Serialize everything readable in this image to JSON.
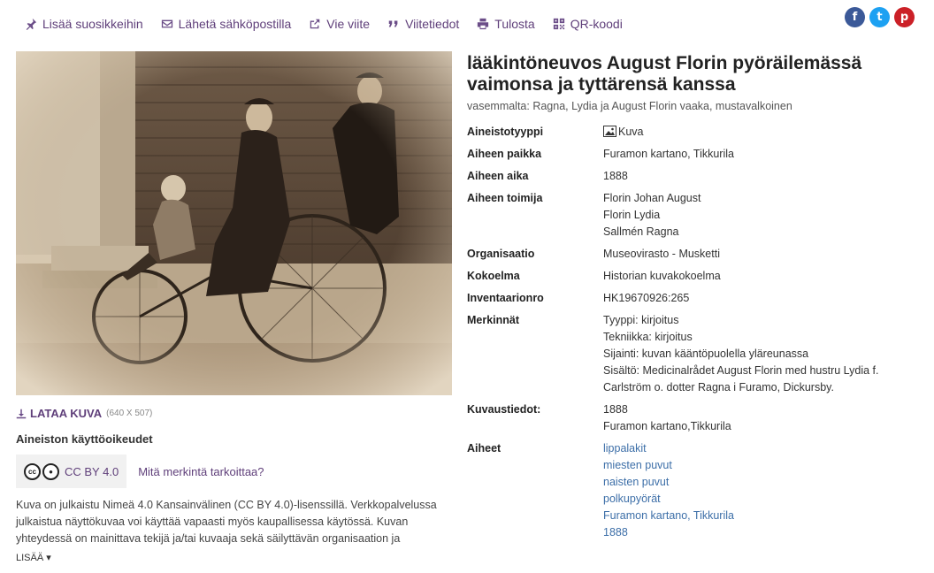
{
  "toolbar": {
    "favorite": "Lisää suosikkeihin",
    "email": "Lähetä sähköpostilla",
    "export": "Vie viite",
    "cite": "Viitetiedot",
    "print": "Tulosta",
    "qr": "QR-koodi"
  },
  "social": [
    "facebook-icon",
    "twitter-icon",
    "pinterest-icon"
  ],
  "image": {
    "download_label": "LATAA KUVA",
    "dimensions": "(640 X 507)"
  },
  "rights": {
    "title": "Aineiston käyttöoikeudet",
    "license": "CC BY 4.0",
    "license_link": "Mitä merkintä tarkoittaa?",
    "text": "Kuva on julkaistu Nimeä 4.0 Kansainvälinen (CC BY 4.0)-lisenssillä. Verkkopalvelussa julkaistua näyttökuvaa voi käyttää vapaasti myös kaupallisessa käytössä. Kuvan yhteydessä on mainittava tekijä ja/tai kuvaaja sekä säilyttävän organisaation ja",
    "more": "LISÄÄ ▾"
  },
  "record": {
    "title": "lääkintöneuvos August Florin pyöräilemässä vaimonsa ja tyttärensä kanssa",
    "subtitle": "vasemmalta: Ragna, Lydia ja August Florin vaaka, mustavalkoinen",
    "fields": {
      "type": {
        "label": "Aineistotyyppi",
        "value": "Kuva"
      },
      "place": {
        "label": "Aiheen paikka",
        "value": "Furamon kartano, Tikkurila"
      },
      "time": {
        "label": "Aiheen aika",
        "value": "1888"
      },
      "actors": {
        "label": "Aiheen toimija",
        "values": [
          "Florin Johan August",
          "Florin Lydia",
          "Sallmén Ragna"
        ]
      },
      "org": {
        "label": "Organisaatio",
        "value": "Museovirasto - Musketti"
      },
      "collection": {
        "label": "Kokoelma",
        "value": "Historian kuvakokoelma"
      },
      "inventory": {
        "label": "Inventaarionro",
        "value": "HK19670926:265"
      },
      "notes": {
        "label": "Merkinnät",
        "values": [
          "Tyyppi: kirjoitus",
          "Tekniikka: kirjoitus",
          "Sijainti: kuvan kääntöpuolella yläreunassa",
          "Sisältö: Medicinalrådet August Florin med hustru Lydia f. Carlström o. dotter Ragna i Furamo, Dickursby."
        ]
      },
      "photo_info": {
        "label": "Kuvaustiedot:",
        "values": [
          "1888",
          "Furamon kartano,Tikkurila"
        ]
      },
      "subjects": {
        "label": "Aiheet",
        "values": [
          "lippalakit",
          "miesten puvut",
          "naisten puvut",
          "polkupyörät",
          "Furamon kartano, Tikkurila",
          "1888"
        ]
      }
    }
  },
  "colors": {
    "accent": "#5f3f7a",
    "link": "#3d6fa8",
    "sepia": "#8a7560"
  }
}
